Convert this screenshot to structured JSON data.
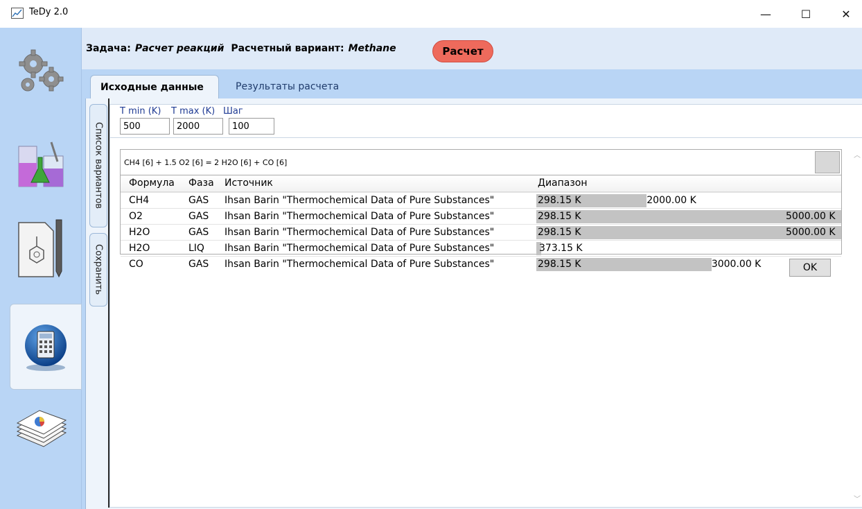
{
  "window": {
    "title": "TeDy 2.0",
    "controls": {
      "minimize": "—",
      "maximize": "☐",
      "close": "✕"
    }
  },
  "nav": [
    {
      "name": "settings-icon"
    },
    {
      "name": "chemistry-icon"
    },
    {
      "name": "document-edit-icon"
    },
    {
      "name": "calculator-icon",
      "active": true
    },
    {
      "name": "report-icon"
    }
  ],
  "task": {
    "label": "Задача:",
    "value": "Расчет реакций",
    "variant_label": "Расчетный вариант:",
    "variant_value": "Methane",
    "calc_button": "Расчет"
  },
  "tabs": [
    {
      "label": "Исходные данные",
      "active": true
    },
    {
      "label": "Результаты расчета",
      "active": false
    }
  ],
  "side_tabs": {
    "variants": "Список вариантов",
    "save": "Сохранить"
  },
  "params": {
    "tmin_label": "T min (K)",
    "tmax_label": "T max (K)",
    "step_label": "Шаг",
    "tmin": "500",
    "tmax": "2000",
    "step": "100"
  },
  "equation": "CH4 [6] + 1.5 O2 [6]  = 2 H2O [6] + CO [6]",
  "table": {
    "headers": [
      "Формула",
      "Фаза",
      "Источник",
      "Диапазон"
    ],
    "rows": [
      {
        "formula": "CH4",
        "phase": "GAS",
        "source": "Ihsan Barin \"Thermochemical Data of Pure Substances\"",
        "t_from": "298.15 K",
        "t_to": "2000.00 K",
        "range_from": 298.15,
        "range_to": 2000.0
      },
      {
        "formula": "O2",
        "phase": "GAS",
        "source": "Ihsan Barin \"Thermochemical Data of Pure Substances\"",
        "t_from": "298.15 K",
        "t_to": "5000.00 K",
        "range_from": 298.15,
        "range_to": 5000.0
      },
      {
        "formula": "H2O",
        "phase": "GAS",
        "source": "Ihsan Barin \"Thermochemical Data of Pure Substances\"",
        "t_from": "298.15 K",
        "t_to": "5000.00 K",
        "range_from": 298.15,
        "range_to": 5000.0
      },
      {
        "formula": "H2O",
        "phase": "LIQ",
        "source": "Ihsan Barin \"Thermochemical Data of Pure Substances\"",
        "t_from": "",
        "t_to": "373.15 K",
        "range_from": 298.15,
        "range_to": 373.15
      },
      {
        "formula": "CO",
        "phase": "GAS",
        "source": "Ihsan Barin \"Thermochemical Data of Pure Substances\"",
        "t_from": "298.15 K",
        "t_to": "3000.00 K",
        "range_from": 298.15,
        "range_to": 3000.0
      }
    ]
  },
  "ok_button": "OK"
}
